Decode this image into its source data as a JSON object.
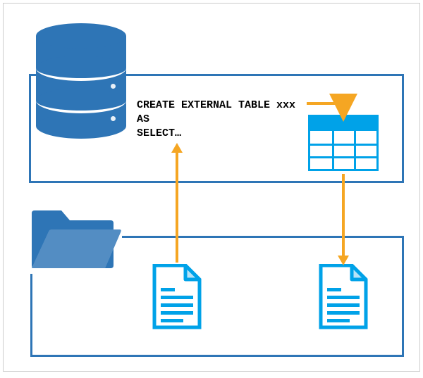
{
  "diagram": {
    "sql": {
      "line1": "CREATE EXTERNAL TABLE xxx",
      "line2": "AS",
      "line3": "SELECT…"
    },
    "sql_full": "CREATE EXTERNAL TABLE xxx\nAS\nSELECT…",
    "colors": {
      "box_border": "#2e75b6",
      "folder": "#2e75b6",
      "accent": "#00a2e8",
      "arrow": "#f5a623"
    },
    "icons": {
      "database": "database-icon",
      "folder": "folder-icon",
      "table": "table-grid-icon",
      "file_left": "file-source-icon",
      "file_right": "file-output-icon"
    },
    "arrows": [
      {
        "name": "sql-to-table",
        "from": "sql-statement",
        "to": "external-table"
      },
      {
        "name": "table-to-output",
        "from": "external-table",
        "to": "file-output"
      },
      {
        "name": "source-to-sql",
        "from": "file-source",
        "to": "sql-statement"
      }
    ]
  }
}
